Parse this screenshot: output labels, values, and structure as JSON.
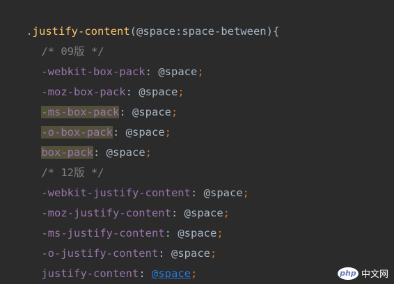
{
  "code": {
    "line1": {
      "dot": ".",
      "selector": "justify-content",
      "open": "(",
      "param": "@space:space-between",
      "close": "){"
    },
    "comment1": "/* 09版 */",
    "decl1": {
      "prop": "-webkit-box-pack",
      "colon": ":",
      "value": "@space",
      "semi": ";"
    },
    "decl2": {
      "prop": "-moz-box-pack",
      "colon": ":",
      "value": "@space",
      "semi": ";"
    },
    "decl3": {
      "prop": "-ms-box-pack",
      "colon": ":",
      "value": "@space",
      "semi": ";"
    },
    "decl4": {
      "prop": "-o-box-pack",
      "colon": ":",
      "value": "@space",
      "semi": ";"
    },
    "decl5": {
      "prop": "box-pack",
      "colon": ":",
      "value": "@space",
      "semi": ";"
    },
    "comment2": "/* 12版 */",
    "decl6": {
      "prop": "-webkit-justify-content",
      "colon": ":",
      "value": "@space",
      "semi": ";"
    },
    "decl7": {
      "prop": "-moz-justify-content",
      "colon": ":",
      "value": "@space",
      "semi": ";"
    },
    "decl8": {
      "prop": "-ms-justify-content",
      "colon": ":",
      "value": "@space",
      "semi": ";"
    },
    "decl9": {
      "prop": "-o-justify-content",
      "colon": ":",
      "value": "@space",
      "semi": ";"
    },
    "decl10": {
      "prop": "justify-content",
      "colon": ":",
      "value": "@space",
      "semi": ";"
    },
    "close_brace": "}"
  },
  "watermark": {
    "logo": "php",
    "text": "中文网"
  },
  "colors": {
    "background": "#2b2b2b",
    "selector": "#ffc66d",
    "property": "#9876aa",
    "comment": "#808080",
    "punctuation": "#cc7832",
    "text": "#a9b7c6",
    "link": "#287bde",
    "highlight": "#52503a"
  }
}
